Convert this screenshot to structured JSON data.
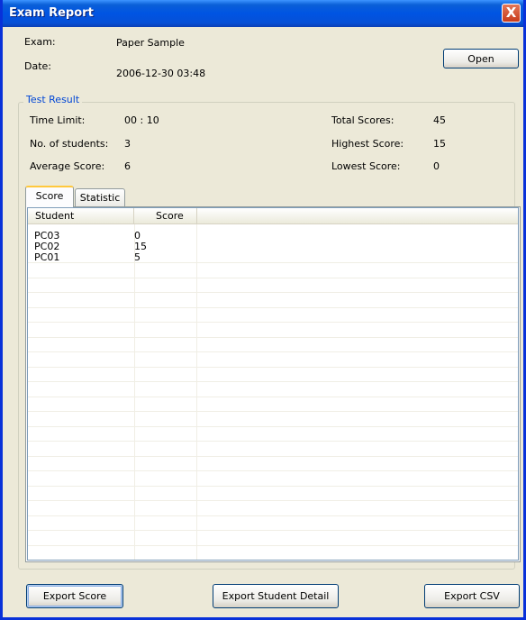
{
  "window": {
    "title": "Exam Report",
    "close_label": "X"
  },
  "exam": {
    "label": "Exam:",
    "value": "Paper Sample",
    "open_button": "Open"
  },
  "date": {
    "label": "Date:",
    "value": "2006-12-30 03:48"
  },
  "test_result": {
    "legend": "Test Result",
    "time_limit": {
      "label": "Time Limit:",
      "value": "00 : 10"
    },
    "students": {
      "label": "No. of students:",
      "value": "3"
    },
    "average": {
      "label": "Average Score:",
      "value": "6"
    },
    "total": {
      "label": "Total Scores:",
      "value": "45"
    },
    "highest": {
      "label": "Highest Score:",
      "value": "15"
    },
    "lowest": {
      "label": "Lowest Score:",
      "value": "0"
    }
  },
  "tabs": [
    {
      "label": "Score",
      "active": true
    },
    {
      "label": "Statistic",
      "active": false
    }
  ],
  "table": {
    "columns": [
      "Student",
      "Score"
    ],
    "rows": [
      {
        "student": "PC03",
        "score": "0"
      },
      {
        "student": "PC02",
        "score": "15"
      },
      {
        "student": "PC01",
        "score": "5"
      }
    ]
  },
  "footer": {
    "export_score": "Export Score",
    "export_student_detail": "Export Student Detail",
    "export_csv": "Export CSV"
  }
}
